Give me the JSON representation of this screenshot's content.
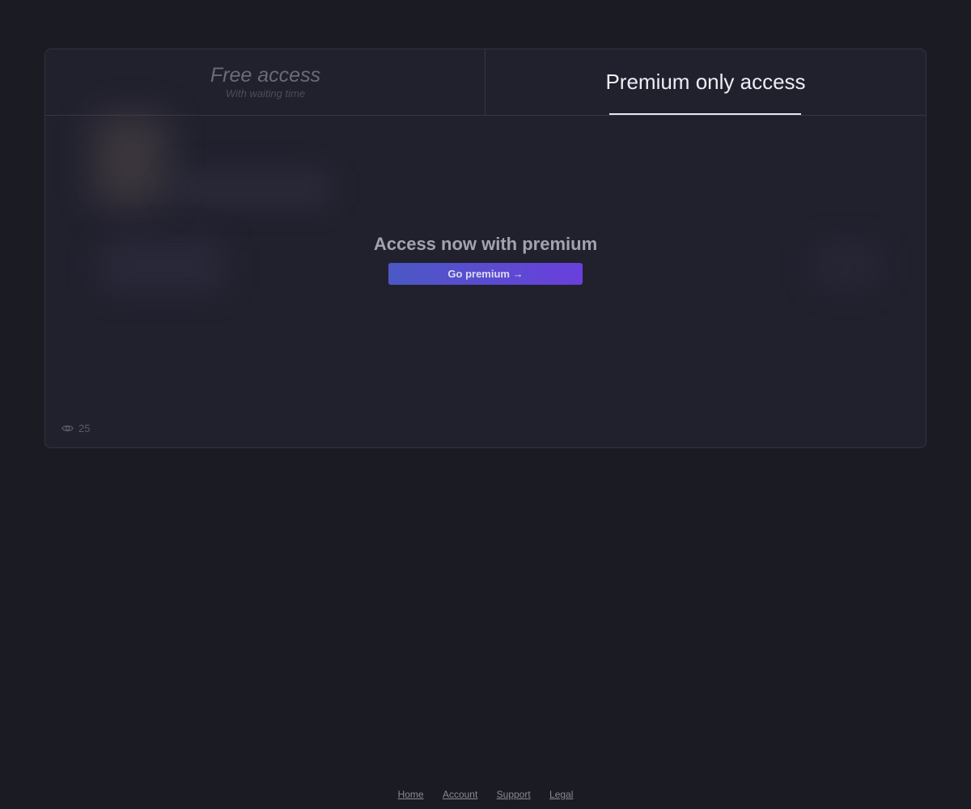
{
  "tabs": {
    "free": {
      "title": "Free access",
      "subtitle": "With waiting time"
    },
    "premium": {
      "title": "Premium only access",
      "selected": true
    }
  },
  "premium_gate": {
    "heading": "Access now with premium",
    "button_label": "Go premium →"
  },
  "stats": {
    "views_icon": "eye-icon",
    "views_count": "25"
  },
  "footer": {
    "links": [
      "Home",
      "Account",
      "Support",
      "Legal"
    ]
  },
  "colors": {
    "background": "#1b1b24",
    "card": "#21212e",
    "button_gradient_start": "#4b58c4",
    "button_gradient_end": "#6a3fdc"
  }
}
